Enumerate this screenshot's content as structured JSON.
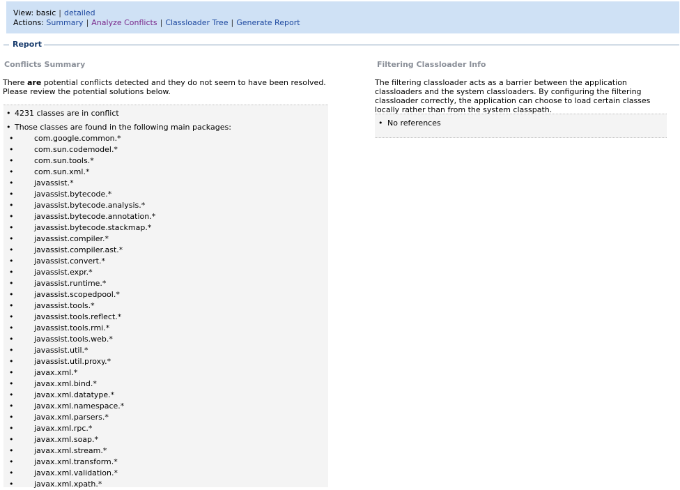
{
  "topbar": {
    "view_label": "View:",
    "view_basic": "basic",
    "view_detailed": "detailed",
    "actions_label": "Actions:",
    "actions": [
      "Summary",
      "Analyze Conflicts",
      "Classloader Tree",
      "Generate Report"
    ]
  },
  "report": {
    "legend": "Report"
  },
  "conflicts": {
    "title": "Conflicts Summary",
    "intro_pre": "There ",
    "intro_bold": "are",
    "intro_post": " potential conflicts detected and they do not seem to have been resolved. Please review the potential solutions below.",
    "count_text": "4231 classes are in conflict",
    "packages_text": "Those classes are found in the following main packages:",
    "packages": [
      "com.google.common.*",
      "com.sun.codemodel.*",
      "com.sun.tools.*",
      "com.sun.xml.*",
      "javassist.*",
      "javassist.bytecode.*",
      "javassist.bytecode.analysis.*",
      "javassist.bytecode.annotation.*",
      "javassist.bytecode.stackmap.*",
      "javassist.compiler.*",
      "javassist.compiler.ast.*",
      "javassist.convert.*",
      "javassist.expr.*",
      "javassist.runtime.*",
      "javassist.scopedpool.*",
      "javassist.tools.*",
      "javassist.tools.reflect.*",
      "javassist.tools.rmi.*",
      "javassist.tools.web.*",
      "javassist.util.*",
      "javassist.util.proxy.*",
      "javax.xml.*",
      "javax.xml.bind.*",
      "javax.xml.datatype.*",
      "javax.xml.namespace.*",
      "javax.xml.parsers.*",
      "javax.xml.rpc.*",
      "javax.xml.soap.*",
      "javax.xml.stream.*",
      "javax.xml.transform.*",
      "javax.xml.validation.*",
      "javax.xml.xpath.*"
    ]
  },
  "filtering": {
    "title": "Filtering Classloader Info",
    "description": "The filtering classloader acts as a barrier between the application classloaders and the system classloaders. By configuring the filtering classloader correctly, the application can choose to load certain classes locally rather than from the system classpath.",
    "no_refs": "No references"
  }
}
